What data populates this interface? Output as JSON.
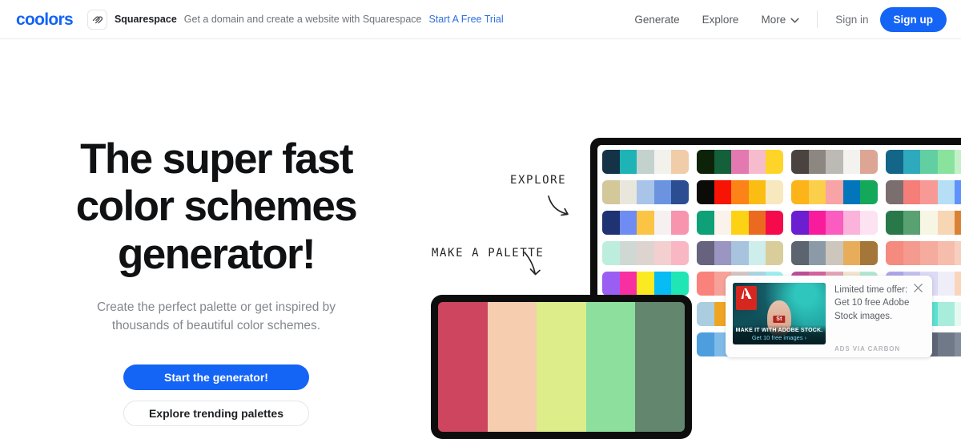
{
  "nav": {
    "logo": "coolors",
    "promo": {
      "icon": "squarespace-icon",
      "brand": "Squarespace",
      "text": "Get a domain and create a website with Squarespace",
      "cta": "Start A Free Trial"
    },
    "links": [
      {
        "label": "Generate"
      },
      {
        "label": "Explore"
      },
      {
        "label": "More",
        "icon": "chevron-down-icon"
      }
    ],
    "sign_in": "Sign in",
    "sign_up": "Sign up",
    "accent_color": "#1464f6"
  },
  "hero": {
    "headline": "The super fast color schemes generator!",
    "subhead": "Create the perfect palette or get inspired by thousands of beautiful color schemes.",
    "primary_button": "Start the generator!",
    "secondary_button": "Explore trending palettes"
  },
  "annotations": [
    {
      "label": "EXPLORE",
      "icon": "curved-arrow-icon"
    },
    {
      "label": "MAKE A PALETTE",
      "icon": "curved-arrow-icon"
    }
  ],
  "ad": {
    "headline": "Limited time offer: Get 10 free Adobe Stock images.",
    "via": "ADS VIA CARBON",
    "close_icon": "close-icon",
    "creative": {
      "brand_icon": "adobe-logo-icon",
      "badge": "St",
      "strapline": "MAKE IT WITH ADOBE STOCK.",
      "link": "Get 10 free images ›"
    }
  },
  "devices": {
    "tablet_palette": [
      "#ce4560",
      "#f6cdaf",
      "#dded8a",
      "#8ddf9e",
      "#63866f"
    ],
    "monitor_palettes": [
      [
        "#153347",
        "#1eb4b6",
        "#c3d2cd",
        "#f3f1ec",
        "#f0cda8"
      ],
      [
        "#0d2309",
        "#13603a",
        "#e379b0",
        "#f6bcce",
        "#ffd429"
      ],
      [
        "#4a433f",
        "#8d8782",
        "#bdbab5",
        "#f3f2ee",
        "#dda694"
      ],
      [
        "#136687",
        "#2fa9bc",
        "#62cfa2",
        "#8ae39d",
        "#c4f0c9"
      ],
      [
        "#f2868e",
        "#f9b8ae",
        "#f7d9cd",
        "#fbeee2",
        "#ffd8c0"
      ],
      [
        "#d3c89a",
        "#e9e7dc",
        "#a8c4e8",
        "#6c93e0",
        "#2d4d92"
      ],
      [
        "#0d0b07",
        "#f71405",
        "#fb8317",
        "#fcbd13",
        "#f7e8bd"
      ],
      [
        "#fcb418",
        "#fbcf49",
        "#f8a3a5",
        "#0275bb",
        "#14a85a"
      ],
      [
        "#7b6e6e",
        "#f57e78",
        "#f79a96",
        "#b6def4",
        "#5f93fb"
      ],
      [
        "#060446",
        "#0c0a5e",
        "#3a4fa7",
        "#2b2b2f",
        "#e6e8ed"
      ],
      [
        "#1f3272",
        "#6f8cf2",
        "#fcc444",
        "#f6f1f0",
        "#f794ae"
      ],
      [
        "#0ea077",
        "#fbf2ec",
        "#fdd215",
        "#ec6a20",
        "#f50b4c"
      ],
      [
        "#6c1fd1",
        "#f81c9c",
        "#fa5cc0",
        "#fbb2db",
        "#fde3f1"
      ],
      [
        "#29784a",
        "#5aa171",
        "#f7f6e4",
        "#f7d6b4",
        "#d98234"
      ],
      [
        "#05064e",
        "#0a0a64",
        "#3e55a6",
        "#2a2a2e",
        "#f05a48"
      ],
      [
        "#bdeedd",
        "#cfd8d3",
        "#ded4cf",
        "#f3cfd0",
        "#f9b7c3"
      ],
      [
        "#67637e",
        "#9a95c1",
        "#a8c3dd",
        "#cdeeeb",
        "#d9cd9b"
      ],
      [
        "#5c6470",
        "#8c9aa7",
        "#ccc6bd",
        "#e8ad5b",
        "#a5763a"
      ],
      [
        "#f58a7f",
        "#f49a8e",
        "#f5ab9d",
        "#f6bdad",
        "#f7cfbf"
      ],
      [
        "#3f59c7",
        "#5f7fe0",
        "#8ba4ec",
        "#b6c6f4",
        "#dbe3fa"
      ],
      [
        "#9a5ff2",
        "#f82fa1",
        "#fbea22",
        "#07bcf4",
        "#1fe6b4"
      ],
      [
        "#f9827c",
        "#f7a299",
        "#d3c7c5",
        "#a9d6e3",
        "#9eeef0"
      ],
      [
        "#bc4f97",
        "#d5639f",
        "#e4a4b7",
        "#f2e5cf",
        "#b3e7d2"
      ],
      [
        "#ada6e8",
        "#c4c0ef",
        "#dcdaf5",
        "#efeef8",
        "#fbd5bb"
      ],
      [
        "#242428",
        "#2c2c31",
        "#3a3a40",
        "#4a4a52",
        "#5c5c66"
      ],
      [
        "#f74ae4",
        "#f980b2",
        "#f7a294",
        "#fac37e",
        "#fcd968"
      ],
      [
        "#aacde0",
        "#f0a522",
        "#f6c84c",
        "#bad7e5",
        "#f2efe9"
      ],
      [
        "#0f3d1c",
        "#1e7a3a",
        "#e13a3a",
        "#1a6fcc",
        "#f5c72a"
      ],
      [
        "#17c4f5",
        "#2ad9e8",
        "#5de0d0",
        "#a8ecdc",
        "#e6f8f2"
      ],
      [
        "#f2604b",
        "#f68f5c",
        "#f9b977",
        "#fbd79a",
        "#fdeccb"
      ],
      [
        "#1b7fa1",
        "#3aa0bb",
        "#c6dce3",
        "#f0ece5",
        "#f4a21c"
      ],
      [
        "#4e9ede",
        "#7fbbe8",
        "#f2f0ec",
        "#fbd63a",
        "#f7477c"
      ],
      [
        "#d13636",
        "#dff0ec",
        "#a8ddd3",
        "#3f87ad",
        "#152f4c"
      ],
      [
        "#3e4455",
        "#4c5364",
        "#5e6675",
        "#707988",
        "#838c9b"
      ],
      [
        "#f1fbe8",
        "#d8f2c4",
        "#b1e8a0",
        "#85d986",
        "#4fc16a"
      ]
    ]
  }
}
